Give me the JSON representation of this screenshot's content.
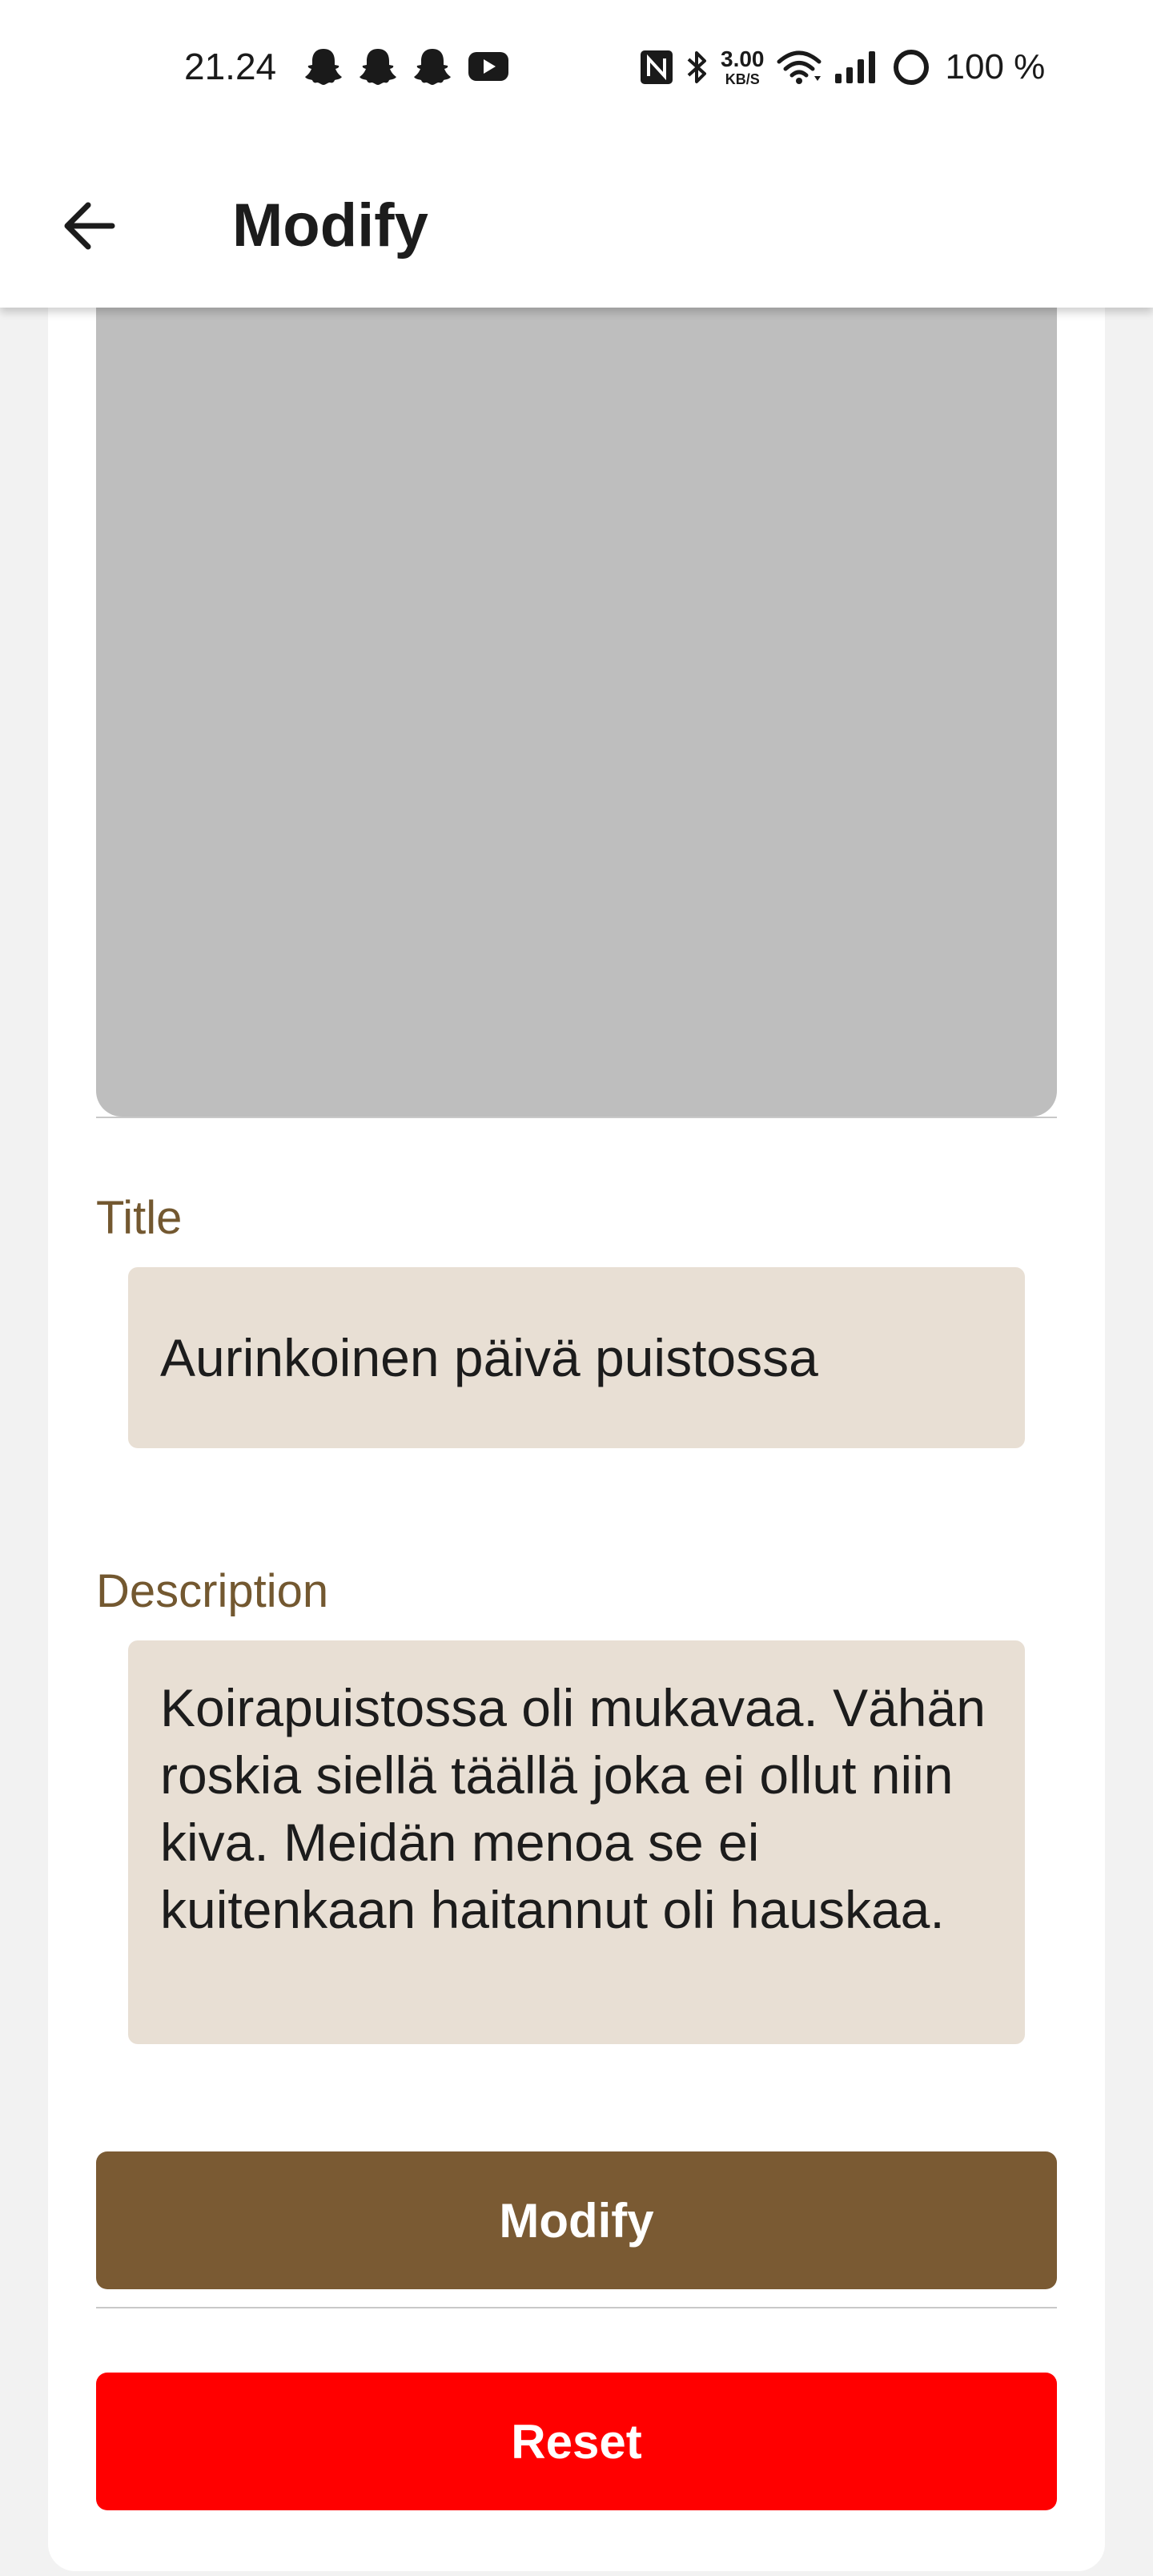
{
  "status_bar": {
    "time": "21.24",
    "notification_icons": [
      "snapchat-ghost-icon",
      "snapchat-ghost-icon",
      "snapchat-ghost-icon",
      "youtube-icon"
    ],
    "net_speed_value": "3.00",
    "net_speed_unit": "KB/S",
    "battery": "100 %"
  },
  "app_bar": {
    "back_icon": "arrow-left-icon",
    "title": "Modify"
  },
  "form": {
    "title_label": "Title",
    "title_value": "Aurinkoinen päivä puistossa",
    "description_label": "Description",
    "description_value": "Koirapuistossa oli mukavaa. Vähän roskia siellä täällä joka ei ollut niin kiva. Meidän menoa se ei kuitenkaan haitannut oli hauskaa.",
    "modify_label": "Modify",
    "reset_label": "Reset"
  },
  "colors": {
    "label_brown": "#735830",
    "field_background": "#e8dfd4",
    "modify_button": "#7a5a33",
    "reset_button": "#ff0000",
    "image_placeholder": "#bebebe"
  }
}
